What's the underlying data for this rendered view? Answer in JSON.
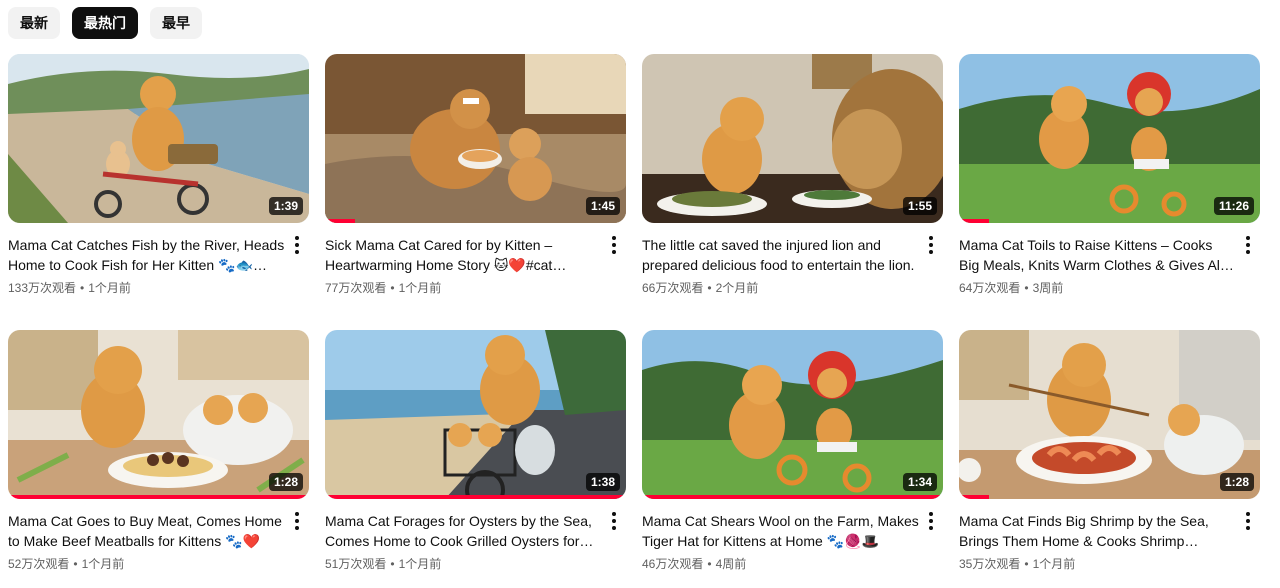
{
  "filters": [
    {
      "label": "最新",
      "active": false
    },
    {
      "label": "最热门",
      "active": true
    },
    {
      "label": "最早",
      "active": false
    }
  ],
  "videos": [
    {
      "title": "Mama Cat Catches Fish by the River, Heads Home to Cook Fish for Her Kitten 🐾🐟#cat…",
      "views": "133万次观看",
      "age": "1个月前",
      "duration": "1:39",
      "progress": 0.0
    },
    {
      "title": "Sick Mama Cat Cared for by Kitten – Heartwarming Home Story 🐱❤️#cat #cute…",
      "views": "77万次观看",
      "age": "1个月前",
      "duration": "1:45",
      "progress": 0.1
    },
    {
      "title": "The little cat saved the injured lion and prepared delicious food to entertain the lion.",
      "views": "66万次观看",
      "age": "2个月前",
      "duration": "1:55",
      "progress": 0.0
    },
    {
      "title": "Mama Cat Toils to Raise Kittens – Cooks Big Meals, Knits Warm Clothes & Gives All Her…",
      "views": "64万次观看",
      "age": "3周前",
      "duration": "11:26",
      "progress": 0.1
    },
    {
      "title": "Mama Cat Goes to Buy Meat, Comes Home to Make Beef Meatballs for Kittens 🐾❤️",
      "views": "52万次观看",
      "age": "1个月前",
      "duration": "1:28",
      "progress": 1.0
    },
    {
      "title": "Mama Cat Forages for Oysters by the Sea, Comes Home to Cook Grilled Oysters for…",
      "views": "51万次观看",
      "age": "1个月前",
      "duration": "1:38",
      "progress": 1.0
    },
    {
      "title": "Mama Cat Shears Wool on the Farm, Makes Tiger Hat for Kittens at Home 🐾🧶🎩",
      "views": "46万次观看",
      "age": "4周前",
      "duration": "1:34",
      "progress": 1.0
    },
    {
      "title": "Mama Cat Finds Big Shrimp by the Sea, Brings Them Home & Cooks Shrimp Feast…",
      "views": "35万次观看",
      "age": "1个月前",
      "duration": "1:28",
      "progress": 0.1
    }
  ]
}
